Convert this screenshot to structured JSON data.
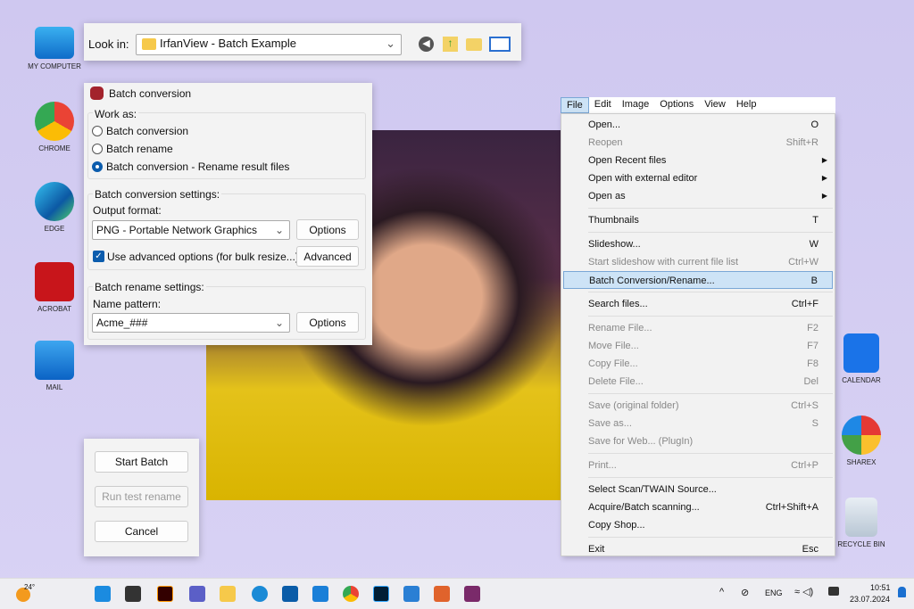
{
  "desktop": {
    "icons": [
      {
        "label": "MY COMPUTER"
      },
      {
        "label": "CHROME"
      },
      {
        "label": "EDGE"
      },
      {
        "label": "ACROBAT"
      },
      {
        "label": "MAIL"
      },
      {
        "label": "CALENDAR"
      },
      {
        "label": "SHAREX"
      },
      {
        "label": "RECYCLE BIN"
      }
    ]
  },
  "lookin": {
    "label": "Look in:",
    "value": "IrfanView - Batch Example"
  },
  "batch": {
    "title": "Batch conversion",
    "work_as": "Work as:",
    "options": [
      "Batch conversion",
      "Batch rename",
      "Batch conversion - Rename result files"
    ],
    "selected": 2,
    "conv_settings": "Batch conversion settings:",
    "output_format_label": "Output format:",
    "output_format": "PNG - Portable Network Graphics",
    "options_btn": "Options",
    "advanced_check": "Use advanced options (for bulk resize...)",
    "advanced_checked": true,
    "advanced_btn": "Advanced",
    "rename_settings": "Batch rename settings:",
    "name_pattern_label": "Name pattern:",
    "name_pattern": "Acme_###",
    "options_btn2": "Options"
  },
  "actions": {
    "start": "Start Batch",
    "test": "Run test rename",
    "cancel": "Cancel"
  },
  "menubar": [
    "File",
    "Edit",
    "Image",
    "Options",
    "View",
    "Help"
  ],
  "file_menu": [
    {
      "label": "Open...",
      "sc": "O"
    },
    {
      "label": "Reopen",
      "sc": "Shift+R",
      "dis": true
    },
    {
      "label": "Open Recent files",
      "sub": true
    },
    {
      "label": "Open with external editor",
      "sub": true
    },
    {
      "label": "Open as",
      "sub": true
    },
    {
      "label": "Thumbnails",
      "sc": "T"
    },
    {
      "label": "Slideshow...",
      "sc": "W"
    },
    {
      "label": "Start slideshow with current file list",
      "sc": "Ctrl+W",
      "dis": true
    },
    {
      "label": "Batch Conversion/Rename...",
      "sc": "B",
      "hl": true
    },
    {
      "label": "Search files...",
      "sc": "Ctrl+F"
    },
    {
      "label": "Rename File...",
      "sc": "F2",
      "dis": true
    },
    {
      "label": "Move File...",
      "sc": "F7",
      "dis": true
    },
    {
      "label": "Copy File...",
      "sc": "F8",
      "dis": true
    },
    {
      "label": "Delete File...",
      "sc": "Del",
      "dis": true
    },
    {
      "label": "Save (original folder)",
      "sc": "Ctrl+S",
      "dis": true
    },
    {
      "label": "Save as...",
      "sc": "S",
      "dis": true
    },
    {
      "label": "Save for Web... (PlugIn)",
      "dis": true
    },
    {
      "label": "Print...",
      "sc": "Ctrl+P",
      "dis": true
    },
    {
      "label": "Select Scan/TWAIN Source..."
    },
    {
      "label": "Acquire/Batch scanning...",
      "sc": "Ctrl+Shift+A"
    },
    {
      "label": "Copy Shop..."
    },
    {
      "label": "Exit",
      "sc": "Esc"
    }
  ],
  "taskbar": {
    "weather": "24°",
    "lang": "ENG",
    "time": "10:51",
    "date": "23.07.2024"
  }
}
